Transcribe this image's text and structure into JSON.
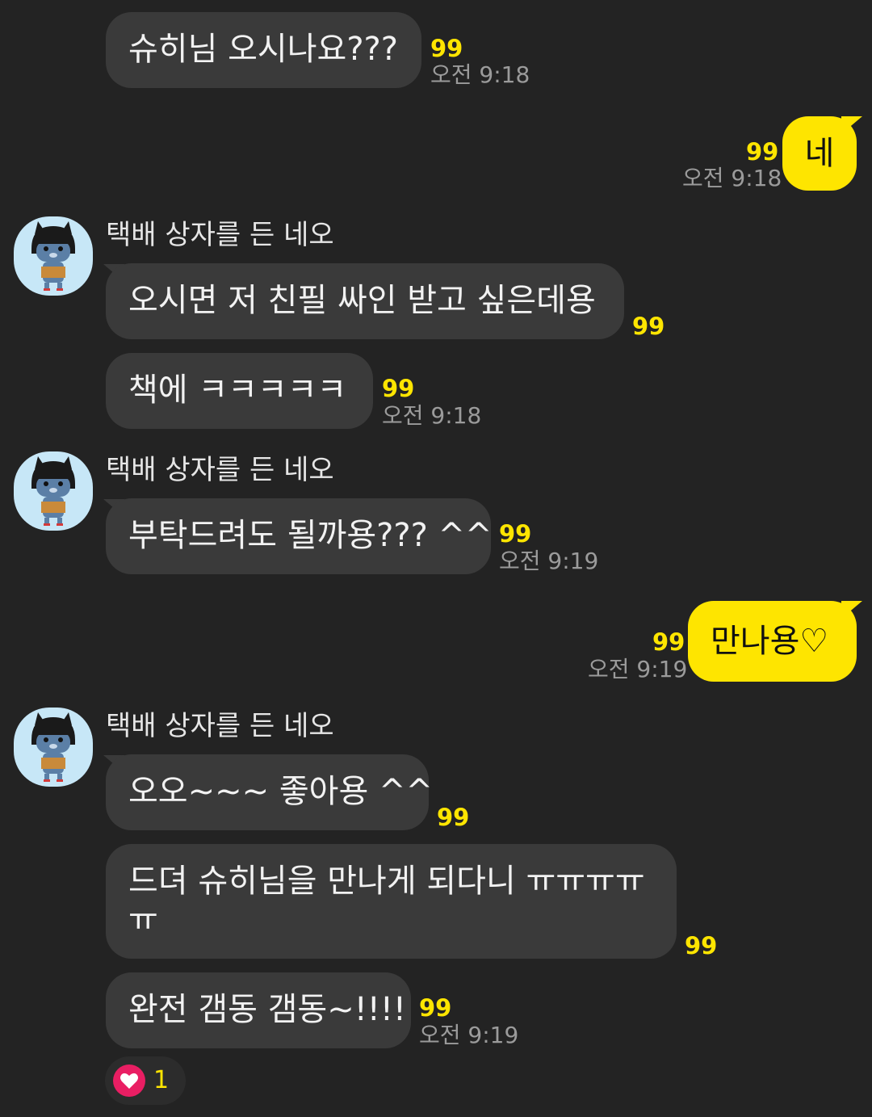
{
  "sender_name": "택배 상자를 든 네오",
  "messages": [
    {
      "text": "슈히님 오시나요???",
      "unread": "99",
      "time": "오전 9:18"
    },
    {
      "text": "네",
      "unread": "99",
      "time": "오전 9:18"
    },
    {
      "text": "오시면 저 친필 싸인 받고 싶은데용",
      "unread": "99"
    },
    {
      "text": "책에 ㅋㅋㅋㅋㅋ",
      "unread": "99",
      "time": "오전 9:18"
    },
    {
      "text": "부탁드려도 될까용??? ^^",
      "unread": "99",
      "time": "오전 9:19"
    },
    {
      "text": "만나용♡",
      "unread": "99",
      "time": "오전 9:19"
    },
    {
      "text": "오오~~~  좋아용 ^^",
      "unread": "99"
    },
    {
      "text": "드뎌 슈히님을 만나게 되다니 ㅠㅠㅠㅠㅠ",
      "unread": "99"
    },
    {
      "text": "완전 갬동 갬동~!!!!",
      "unread": "99",
      "time": "오전 9:19"
    }
  ],
  "reaction": {
    "icon": "heart-icon",
    "count": "1",
    "color": "#e91e63"
  },
  "colors": {
    "background": "#232323",
    "bubble_other": "#3a3a3a",
    "bubble_mine": "#fee500",
    "unread": "#fee500"
  }
}
